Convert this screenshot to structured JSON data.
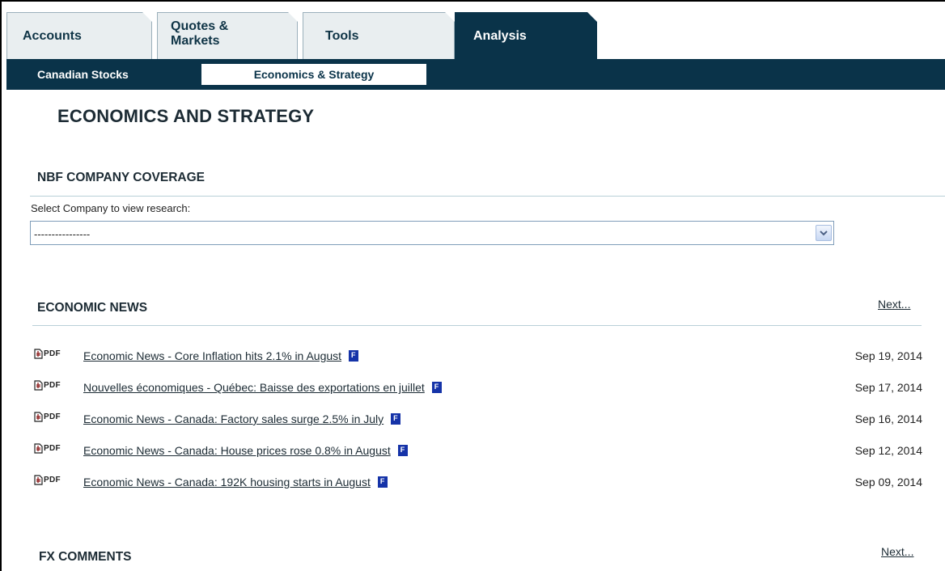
{
  "tabs": {
    "accounts": "Accounts",
    "quotes_markets": "Quotes & Markets",
    "tools": "Tools",
    "analysis": "Analysis",
    "active": "analysis"
  },
  "subnav": {
    "canadian_stocks": "Canadian Stocks",
    "economics_strategy": "Economics & Strategy"
  },
  "page": {
    "title": "ECONOMICS AND STRATEGY"
  },
  "coverage": {
    "heading": "NBF COMPANY COVERAGE",
    "select_label": "Select Company to view research:",
    "selected_value": "----------------"
  },
  "economic_news": {
    "heading": "ECONOMIC NEWS",
    "next_label": "Next...",
    "pdf_label": "PDF",
    "lang_badge": "F",
    "items": [
      {
        "title": "Economic News - Core Inflation hits 2.1% in August",
        "date": "Sep 19, 2014"
      },
      {
        "title": "Nouvelles économiques - Québec: Baisse des exportations en juillet",
        "date": "Sep 17, 2014"
      },
      {
        "title": "Economic News - Canada: Factory sales surge 2.5% in July",
        "date": "Sep 16, 2014"
      },
      {
        "title": "Economic News - Canada: House prices rose 0.8% in August",
        "date": "Sep 12, 2014"
      },
      {
        "title": "Economic News - Canada: 192K housing starts in August",
        "date": "Sep 09, 2014"
      }
    ]
  },
  "fx_comments": {
    "heading": "FX COMMENTS",
    "next_label": "Next..."
  },
  "colors": {
    "navy": "#0a3349",
    "tab_bg": "#e9eef0",
    "rule": "#b9d0d8",
    "lang_icon": "#1533a8"
  }
}
